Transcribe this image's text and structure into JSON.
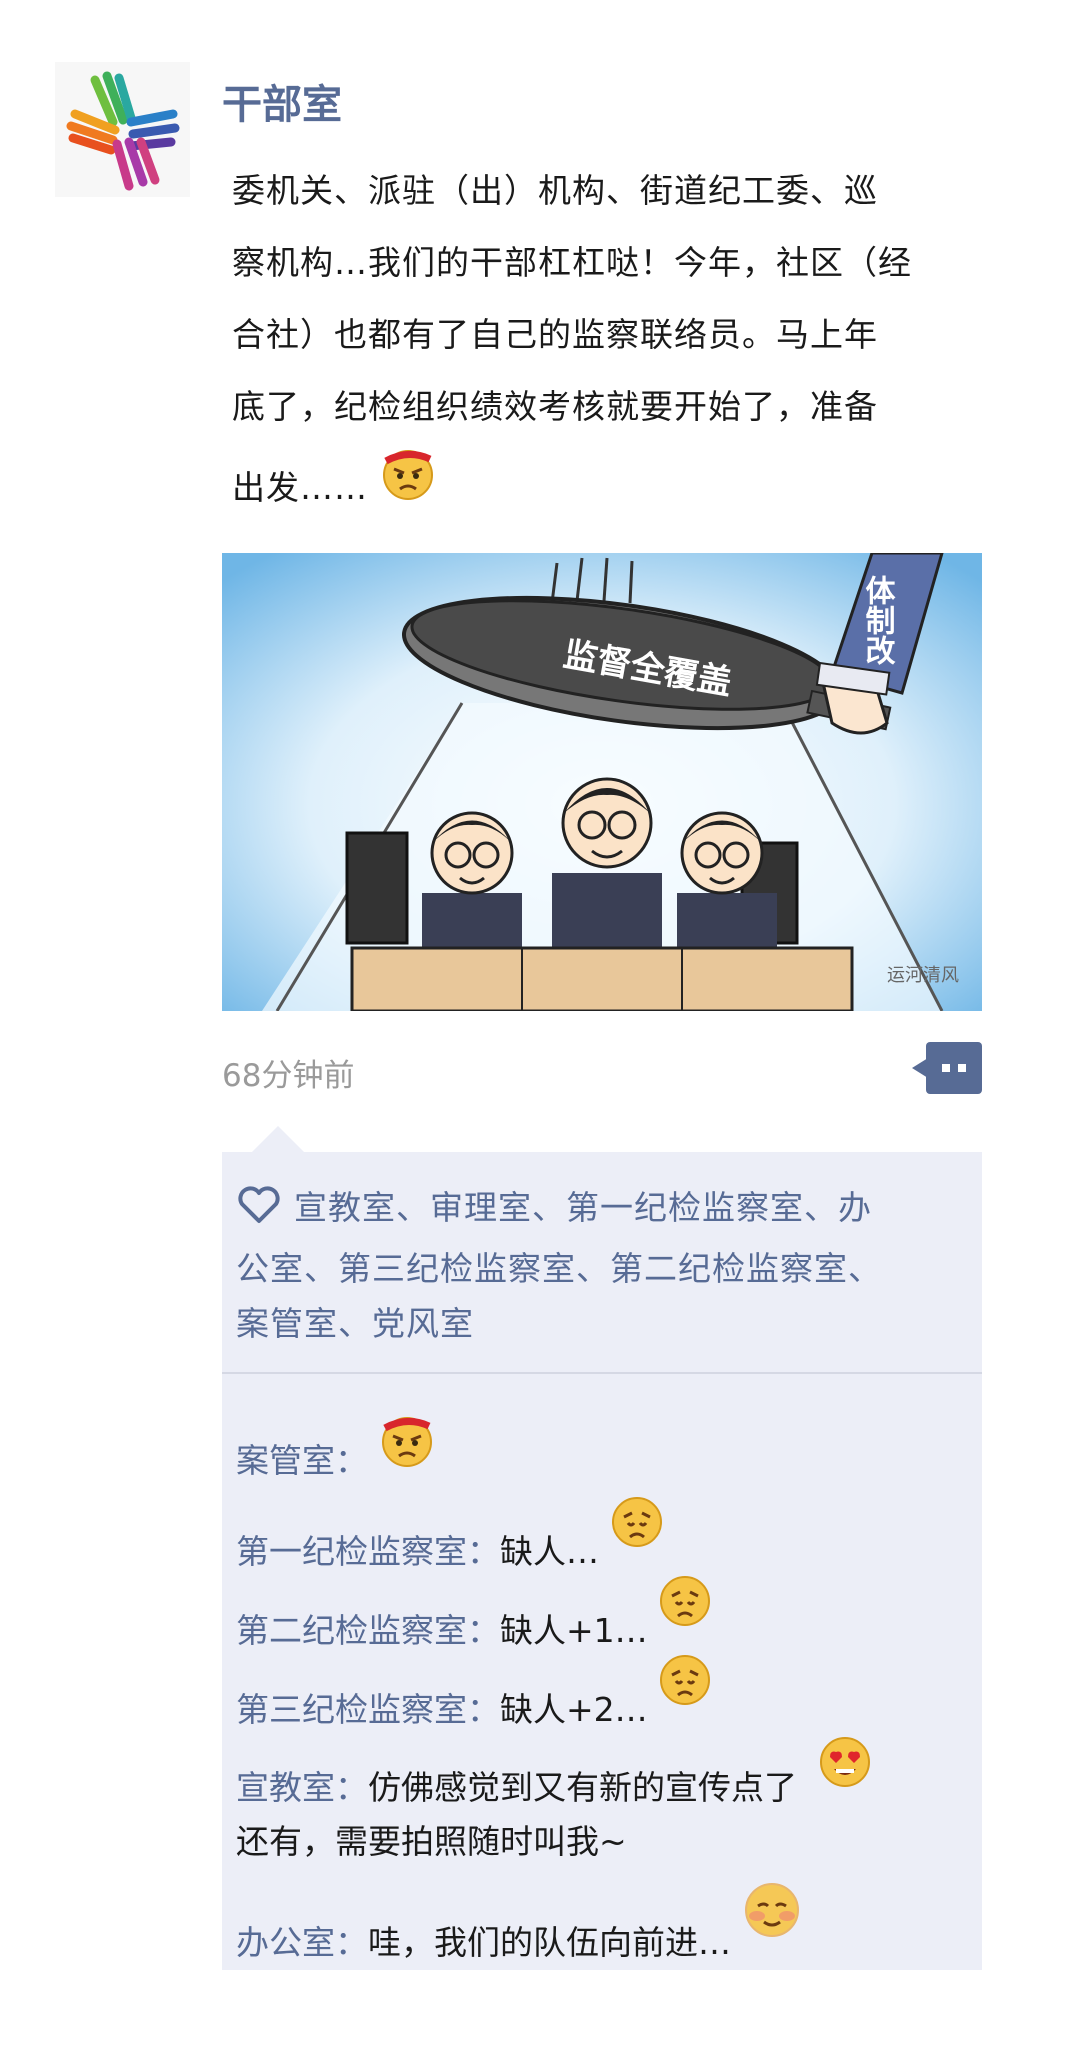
{
  "post": {
    "author": "干部室",
    "text_lines": [
      "委机关、派驻（出）机构、街道纪工委、巡",
      "察机构…我们的干部杠杠哒！今年，社区（经",
      "合社）也都有了自己的监察联络员。马上年",
      "底了，纪检组织绩效考核就要开始了，准备",
      "出发……"
    ],
    "text_emoji": "angry-face-emoji",
    "image": {
      "banner_text": "监督全覆盖",
      "arm_text": "体制改",
      "watermark": "运河清风"
    },
    "timestamp": "68分钟前",
    "more_icon": "comment-more-icon"
  },
  "likes": {
    "icon": "heart-icon",
    "lines": [
      "宣教室、审理室、第一纪检监察室、办",
      "公室、第三纪检监察室、第二纪检监察室、",
      "案管室、党风室"
    ]
  },
  "comments": [
    {
      "name": "案管室：",
      "text": "",
      "emoji": "angry-face-emoji"
    },
    {
      "name": "第一纪检监察室：",
      "text": "缺人…",
      "emoji": "sad-face-emoji"
    },
    {
      "name": "第二纪检监察室：",
      "text": "缺人+1…",
      "emoji": "sad-face-emoji"
    },
    {
      "name": "第三纪检监察室：",
      "text": "缺人+2…",
      "emoji": "sad-face-emoji"
    },
    {
      "name": "宣教室：",
      "text": "仿佛感觉到又有新的宣传点了",
      "text2": " 还有，需要拍照随时叫我~",
      "emoji": "heart-eyes-emoji"
    },
    {
      "name": "办公室：",
      "text": "哇，我们的队伍向前进…",
      "emoji": "blush-face-emoji"
    }
  ],
  "colors": {
    "name_blue": "#576b95",
    "panel_bg": "#eceef7",
    "timestamp_gray": "#9a9a9a"
  }
}
